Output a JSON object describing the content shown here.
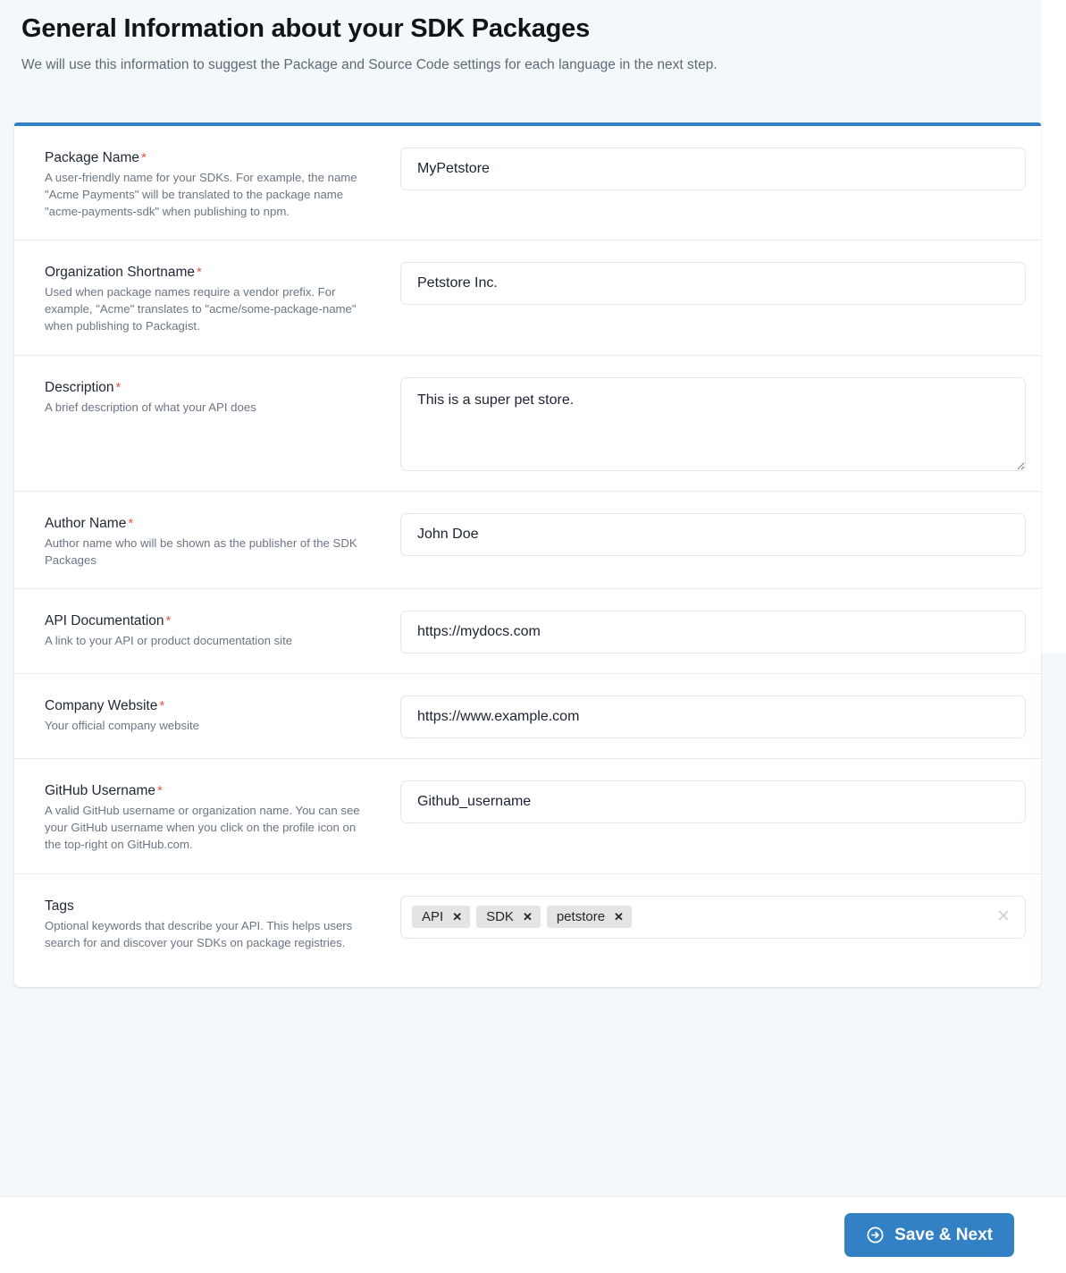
{
  "header": {
    "title": "General Information about your SDK Packages",
    "subtitle": "We will use this information to suggest the Package and Source Code settings for each language in the next step."
  },
  "colors": {
    "accent": "#3281c4",
    "required": "#e4584f",
    "page_bg": "#f4f8fb",
    "chip_bg": "#e4e4e4",
    "border": "#e3e8ef"
  },
  "fields": [
    {
      "name": "package-name",
      "label": "Package Name",
      "required": true,
      "required_marker": "*",
      "help": "A user-friendly name for your SDKs. For example, the name \"Acme Payments\" will be translated to the package name \"acme-payments-sdk\" when publishing to npm.",
      "type": "text",
      "value": "MyPetstore",
      "placeholder": ""
    },
    {
      "name": "organization-shortname",
      "label": "Organization Shortname",
      "required": true,
      "required_marker": "*",
      "help": "Used when package names require a vendor prefix. For example, \"Acme\" translates to \"acme/some-package-name\" when publishing to Packagist.",
      "type": "text",
      "value": "Petstore Inc.",
      "placeholder": ""
    },
    {
      "name": "description",
      "label": "Description",
      "required": true,
      "required_marker": "*",
      "help": "A brief description of what your API does",
      "type": "textarea",
      "value": "This is a super pet store.",
      "placeholder": ""
    },
    {
      "name": "author-name",
      "label": "Author Name",
      "required": true,
      "required_marker": "*",
      "help": "Author name who will be shown as the publisher of the SDK Packages",
      "type": "text",
      "value": "John Doe",
      "placeholder": ""
    },
    {
      "name": "api-documentation",
      "label": "API Documentation",
      "required": true,
      "required_marker": "*",
      "help": "A link to your API or product documentation site",
      "type": "text",
      "value": "https://mydocs.com",
      "placeholder": ""
    },
    {
      "name": "company-website",
      "label": "Company Website",
      "required": true,
      "required_marker": "*",
      "help": "Your official company website",
      "type": "text",
      "value": "https://www.example.com",
      "placeholder": ""
    },
    {
      "name": "github-username",
      "label": "GitHub Username",
      "required": true,
      "required_marker": "*",
      "help": "A valid GitHub username or organization name. You can see your GitHub username when you click on the profile icon on the top-right on GitHub.com.",
      "type": "text",
      "value": "Github_username",
      "placeholder": ""
    },
    {
      "name": "tags",
      "label": "Tags",
      "required": false,
      "required_marker": "",
      "help": "Optional keywords that describe your API. This helps users search for and discover your SDKs on package registries.",
      "type": "tags",
      "tags": [
        "API",
        "SDK",
        "petstore"
      ],
      "tag_remove_glyph": "✕",
      "clear_all_glyph": "✕",
      "placeholder": ""
    }
  ],
  "footer": {
    "primary_button": {
      "label": "Save & Next",
      "icon": "arrow-right-circle-icon"
    }
  }
}
